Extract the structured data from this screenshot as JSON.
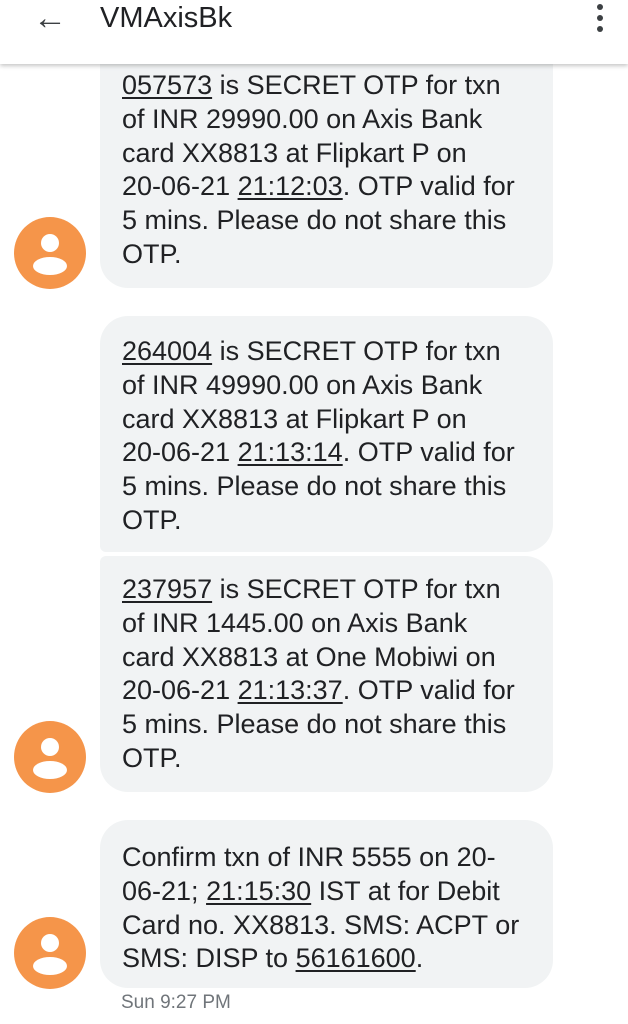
{
  "header": {
    "back_icon": "arrow-back-icon",
    "title": "VMAxisBk",
    "menu_icon": "more-vert-icon"
  },
  "messages": [
    {
      "otp": "057573",
      "l1": " is SECRET OTP for txn",
      "l2": "of INR 29990.00 on Axis Bank",
      "l3": "card XX8813 at Flipkart P on",
      "date": "20-06-21 ",
      "time": "21:12:03",
      "l4b": ". OTP valid for",
      "l5": "5 mins. Please do not share this",
      "l6": "OTP."
    },
    {
      "otp": "264004",
      "l1": " is SECRET OTP for txn",
      "l2": "of INR 49990.00 on Axis Bank",
      "l3": "card XX8813 at Flipkart P on",
      "date": "20-06-21 ",
      "time": "21:13:14",
      "l4b": ". OTP valid for",
      "l5": "5 mins. Please do not share this",
      "l6": "OTP."
    },
    {
      "otp": "237957",
      "l1": " is SECRET OTP for txn",
      "l2": "of INR 1445.00 on Axis Bank",
      "l3": "card XX8813 at One Mobiwi on",
      "date": "20-06-21 ",
      "time": "21:13:37",
      "l4b": ". OTP valid for",
      "l5": "5 mins. Please do not share this",
      "l6": "OTP."
    },
    {
      "l1": "Confirm txn of INR 5555 on 20-",
      "l2a": "06-21; ",
      "time": "21:15:30",
      "l2b": " IST at  for Debit",
      "l3": "Card no. XX8813. SMS: ACPT or",
      "l4a": "SMS: DISP to ",
      "number": "56161600",
      "l4b": "."
    }
  ],
  "timestamp": "Sun 9:27 PM",
  "colors": {
    "avatar": "#f5954a",
    "bubble": "#f1f3f4",
    "text": "#202124",
    "muted": "#70757a"
  }
}
